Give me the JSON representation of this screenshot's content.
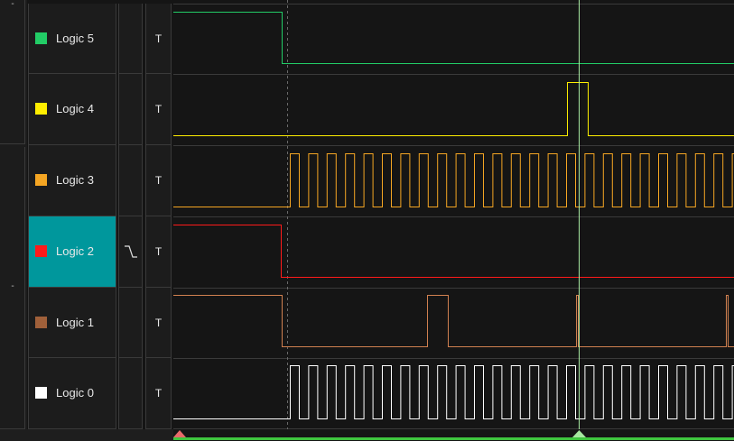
{
  "groups": {
    "top_marker": "-",
    "bottom_marker": "-"
  },
  "channels": [
    {
      "name": "Logic 5",
      "color": "#22cc66",
      "trigger": "T",
      "selected": false
    },
    {
      "name": "Logic 4",
      "color": "#ffee00",
      "trigger": "T",
      "selected": false
    },
    {
      "name": "Logic 3",
      "color": "#f5a623",
      "trigger": "T",
      "selected": false
    },
    {
      "name": "Logic 2",
      "color": "#ff1a1a",
      "trigger": "T",
      "selected": true,
      "edge_trigger": "falling-edge"
    },
    {
      "name": "Logic 1",
      "color": "#a0603a",
      "trigger": "T",
      "selected": false
    },
    {
      "name": "Logic 0",
      "color": "#ffffff",
      "trigger": "T",
      "selected": false
    }
  ],
  "colors": {
    "background": "#151515",
    "panel": "#1c1c1c",
    "grid": "#3a3a3a",
    "selected_row": "#00979c",
    "cursor": "#a6e8a0",
    "timeline": "#3ec43e",
    "trigger_marker": "#e86a6a",
    "logic5": "#22cc66",
    "logic4": "#ffee00",
    "logic3": "#f5a623",
    "logic2": "#ff1a1a",
    "logic1": "#a0603a",
    "logic0": "#ffffff"
  }
}
